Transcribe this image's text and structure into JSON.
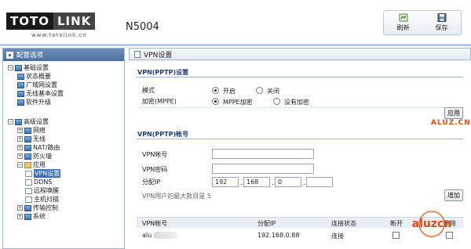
{
  "brand": {
    "logo_part1": "TOTO",
    "logo_part2": "LINK",
    "url": "www.totolink.cn",
    "model": "N5004"
  },
  "toolbar": {
    "refresh_label": "刷新",
    "save_label": "保存"
  },
  "sidebar": {
    "title": "配置选项",
    "basic_group": "基础设置",
    "basic_items": [
      "状态概要",
      "广域网设置",
      "无线基本设置",
      "软件升级"
    ],
    "advanced_group": "高级设置",
    "advanced_items": [
      "网络",
      "无线",
      "NAT/路由",
      "防火墙"
    ],
    "app_group": "应用",
    "app_items": [
      "VPN设置",
      "DDNS",
      "远程唤醒",
      "主机扫描"
    ],
    "more_items": [
      "传输控制",
      "系统"
    ]
  },
  "main": {
    "title": "VPN设置",
    "pptp_settings": {
      "title": "VPN(PPTP)设置",
      "mode_label": "模式",
      "mode_on": "开启",
      "mode_off": "关闭",
      "encrypt_label": "加密(MPPE)",
      "encrypt_on": "MPPE加密",
      "encrypt_off": "没有加密",
      "apply_label": "应用"
    },
    "pptp_account": {
      "title": "VPN(PPTP)帐号",
      "account_label": "VPN帐号",
      "password_label": "VPN密码",
      "ip_label": "分配IP",
      "ip_parts": [
        "192",
        "168",
        "0",
        ""
      ],
      "max_users_note": "VPN用户的最大数目是 5",
      "add_label": "增加"
    },
    "table": {
      "headers": [
        "VPN帐号",
        "分配IP",
        "连接状态",
        "断开",
        "删除"
      ],
      "rows": [
        {
          "account": "alu",
          "ip": "192.168.0.88",
          "status": "连接"
        }
      ]
    }
  },
  "watermark": {
    "text1": "ALUZ.CN",
    "text2": "aluzcn"
  }
}
